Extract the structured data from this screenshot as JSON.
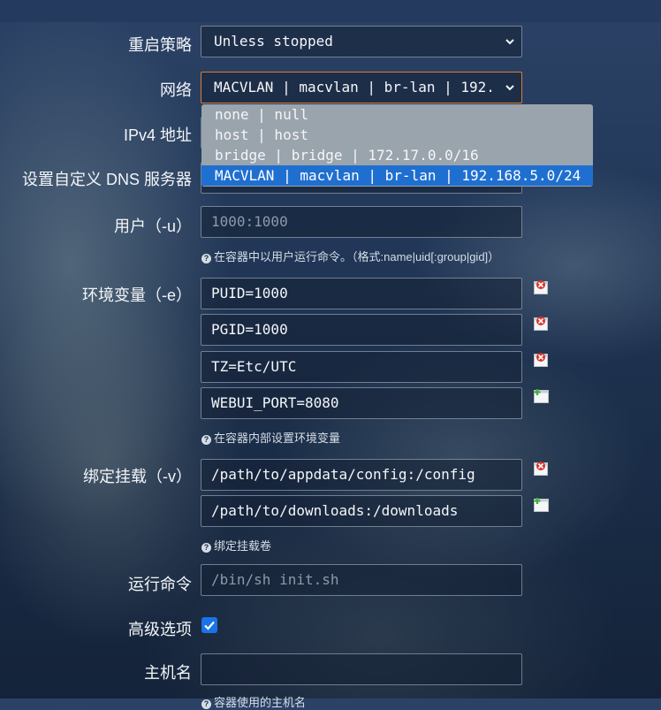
{
  "restart": {
    "label": "重启策略",
    "value": "Unless stopped"
  },
  "network": {
    "label": "网络",
    "value": "MACVLAN | macvlan | br-lan | 192.",
    "options": [
      "none | null",
      "host | host",
      "bridge | bridge | 172.17.0.0/16",
      "MACVLAN | macvlan | br-lan | 192.168.5.0/24"
    ]
  },
  "ipv4": {
    "label": "IPv4 地址"
  },
  "dns": {
    "label": "设置自定义 DNS 服务器"
  },
  "user": {
    "label": "用户（-u）",
    "placeholder": "1000:1000",
    "hint": "在容器中以用户运行命令。（格式:name|uid[:group|gid]）"
  },
  "env": {
    "label": "环境变量（-e）",
    "values": [
      "PUID=1000",
      "PGID=1000",
      "TZ=Etc/UTC",
      "WEBUI_PORT=8080"
    ],
    "hint": "在容器内部设置环境变量"
  },
  "mounts": {
    "label": "绑定挂载（-v）",
    "values": [
      "/path/to/appdata/config:/config",
      "/path/to/downloads:/downloads"
    ],
    "hint": "绑定挂载卷"
  },
  "command": {
    "label": "运行命令",
    "placeholder": "/bin/sh init.sh"
  },
  "advanced": {
    "label": "高级选项",
    "checked": true
  },
  "hostname": {
    "label": "主机名",
    "hint": "容器使用的主机名"
  },
  "colors": {
    "accent": "#1a73e8",
    "focus_border": "#e07b2e",
    "remove": "#d9332b",
    "add": "#3fae3a"
  }
}
